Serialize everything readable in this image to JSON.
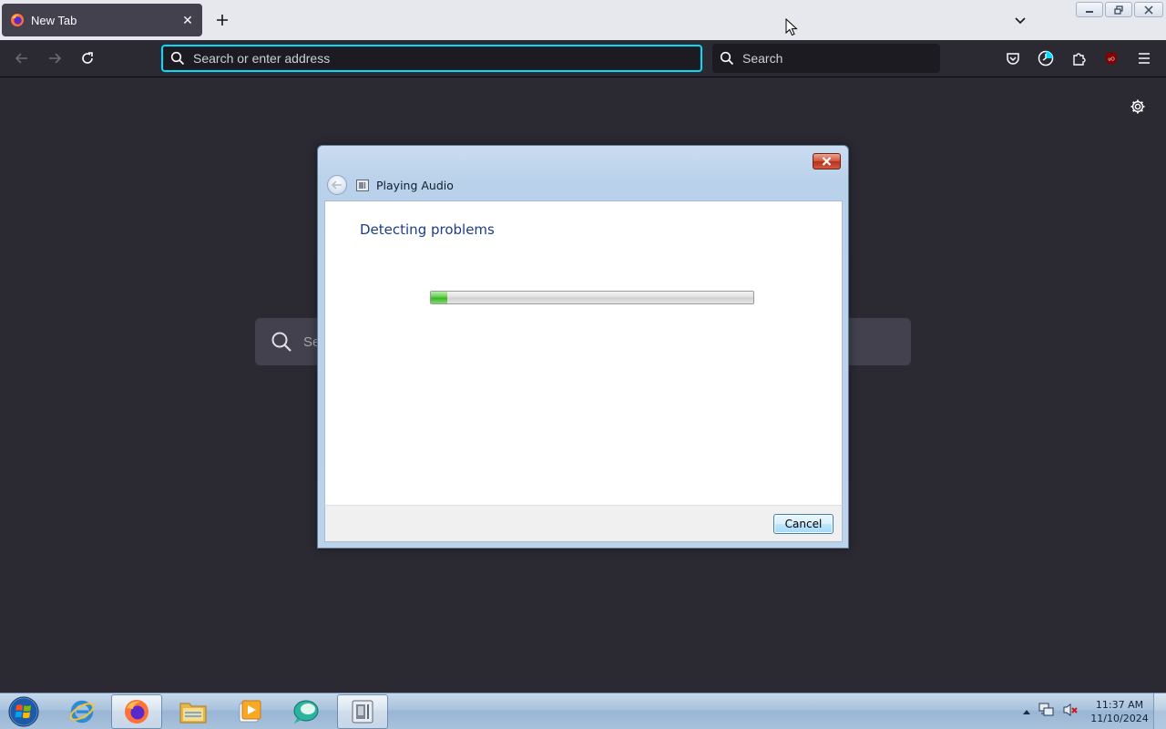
{
  "browser": {
    "tab": {
      "title": "New Tab",
      "favicon": "firefox-icon",
      "close_icon": "close-icon"
    },
    "newtab_icon": "plus-icon",
    "list_tabs_icon": "chevron-down-icon",
    "window_controls": [
      "minimize-icon",
      "restore-icon",
      "close-icon"
    ],
    "nav": {
      "back_icon": "back-arrow-icon",
      "forward_icon": "forward-arrow-icon",
      "reload_icon": "reload-icon"
    },
    "urlbar": {
      "placeholder": "Search or enter address",
      "value": ""
    },
    "searchbar": {
      "placeholder": "Search"
    },
    "toolbar_icons": [
      "pocket-icon",
      "history-icon",
      "extensions-icon",
      "ublock-icon",
      "menu-icon"
    ],
    "ublock_badge": "uO"
  },
  "newtab_page": {
    "settings_icon": "gear-icon",
    "search_placeholder_visible": "Se"
  },
  "dialog": {
    "title": "Playing Audio",
    "heading": "Detecting problems",
    "progress": 0.05,
    "cancel_label": "Cancel",
    "colors": {
      "heading": "#1a3f86",
      "progress": "#37b024"
    }
  },
  "taskbar": {
    "items": [
      "internet-explorer-icon",
      "firefox-icon",
      "file-explorer-icon",
      "media-player-icon",
      "app-icon",
      "troubleshooter-icon"
    ],
    "clock": {
      "time": "11:37 AM",
      "date": "11/10/2024"
    },
    "tray_icons": [
      "show-hidden-icons-icon",
      "network-icon",
      "volume-muted-icon"
    ]
  },
  "colors": {
    "browser_bg": "#2b2a33",
    "urlbar_focus": "#00ddff",
    "tab_active": "#42414d"
  }
}
